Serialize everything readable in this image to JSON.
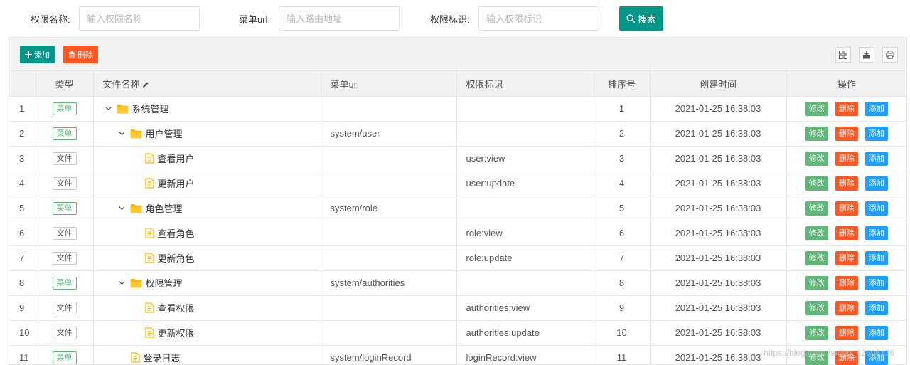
{
  "search": {
    "name_label": "权限名称:",
    "name_placeholder": "输入权限名称",
    "url_label": "菜单url:",
    "url_placeholder": "输入路由地址",
    "perm_label": "权限标识:",
    "perm_placeholder": "输入权限标识",
    "search_button": "搜索"
  },
  "toolbar": {
    "add_label": "添加",
    "delete_label": "删除",
    "tools": [
      "columns-icon",
      "export-icon",
      "print-icon"
    ]
  },
  "table": {
    "headers": {
      "type": "类型",
      "name": "文件名称",
      "url": "菜单url",
      "perm": "权限标识",
      "order": "排序号",
      "created": "创建时间",
      "ops": "操作"
    },
    "op_labels": {
      "edit": "修改",
      "delete": "删除",
      "add": "添加"
    },
    "rows": [
      {
        "index": "1",
        "type": "菜单",
        "kind": "menu",
        "level": 0,
        "node": "folder",
        "name": "系统管理",
        "url": "",
        "perm": "",
        "order": "1",
        "created": "2021-01-25 16:38:03"
      },
      {
        "index": "2",
        "type": "菜单",
        "kind": "menu",
        "level": 1,
        "node": "folder",
        "name": "用户管理",
        "url": "system/user",
        "perm": "",
        "order": "2",
        "created": "2021-01-25 16:38:03"
      },
      {
        "index": "3",
        "type": "文件",
        "kind": "file",
        "level": 2,
        "node": "doc",
        "name": "查看用户",
        "url": "",
        "perm": "user:view",
        "order": "3",
        "created": "2021-01-25 16:38:03"
      },
      {
        "index": "4",
        "type": "文件",
        "kind": "file",
        "level": 2,
        "node": "doc",
        "name": "更新用户",
        "url": "",
        "perm": "user:update",
        "order": "4",
        "created": "2021-01-25 16:38:03"
      },
      {
        "index": "5",
        "type": "菜单",
        "kind": "menu",
        "level": 1,
        "node": "folder",
        "name": "角色管理",
        "url": "system/role",
        "perm": "",
        "order": "5",
        "created": "2021-01-25 16:38:03"
      },
      {
        "index": "6",
        "type": "文件",
        "kind": "file",
        "level": 2,
        "node": "doc",
        "name": "查看角色",
        "url": "",
        "perm": "role:view",
        "order": "6",
        "created": "2021-01-25 16:38:03"
      },
      {
        "index": "7",
        "type": "文件",
        "kind": "file",
        "level": 2,
        "node": "doc",
        "name": "更新角色",
        "url": "",
        "perm": "role:update",
        "order": "7",
        "created": "2021-01-25 16:38:03"
      },
      {
        "index": "8",
        "type": "菜单",
        "kind": "menu",
        "level": 1,
        "node": "folder",
        "name": "权限管理",
        "url": "system/authorities",
        "perm": "",
        "order": "8",
        "created": "2021-01-25 16:38:03"
      },
      {
        "index": "9",
        "type": "文件",
        "kind": "file",
        "level": 2,
        "node": "doc",
        "name": "查看权限",
        "url": "",
        "perm": "authorities:view",
        "order": "9",
        "created": "2021-01-25 16:38:03"
      },
      {
        "index": "10",
        "type": "文件",
        "kind": "file",
        "level": 2,
        "node": "doc",
        "name": "更新权限",
        "url": "",
        "perm": "authorities:update",
        "order": "10",
        "created": "2021-01-25 16:38:03"
      },
      {
        "index": "11",
        "type": "菜单",
        "kind": "menu",
        "level": 1,
        "node": "doc",
        "name": "登录日志",
        "url": "system/loginRecord",
        "perm": "loginRecord:view",
        "order": "11",
        "created": "2021-01-25 16:38:03"
      }
    ]
  },
  "watermark": "https://blog.csdn.net/qq_42606136",
  "colors": {
    "primary": "#009688",
    "danger": "#ff5722",
    "success": "#5fb878",
    "info": "#1e9fff",
    "folder": "#ffb800"
  }
}
